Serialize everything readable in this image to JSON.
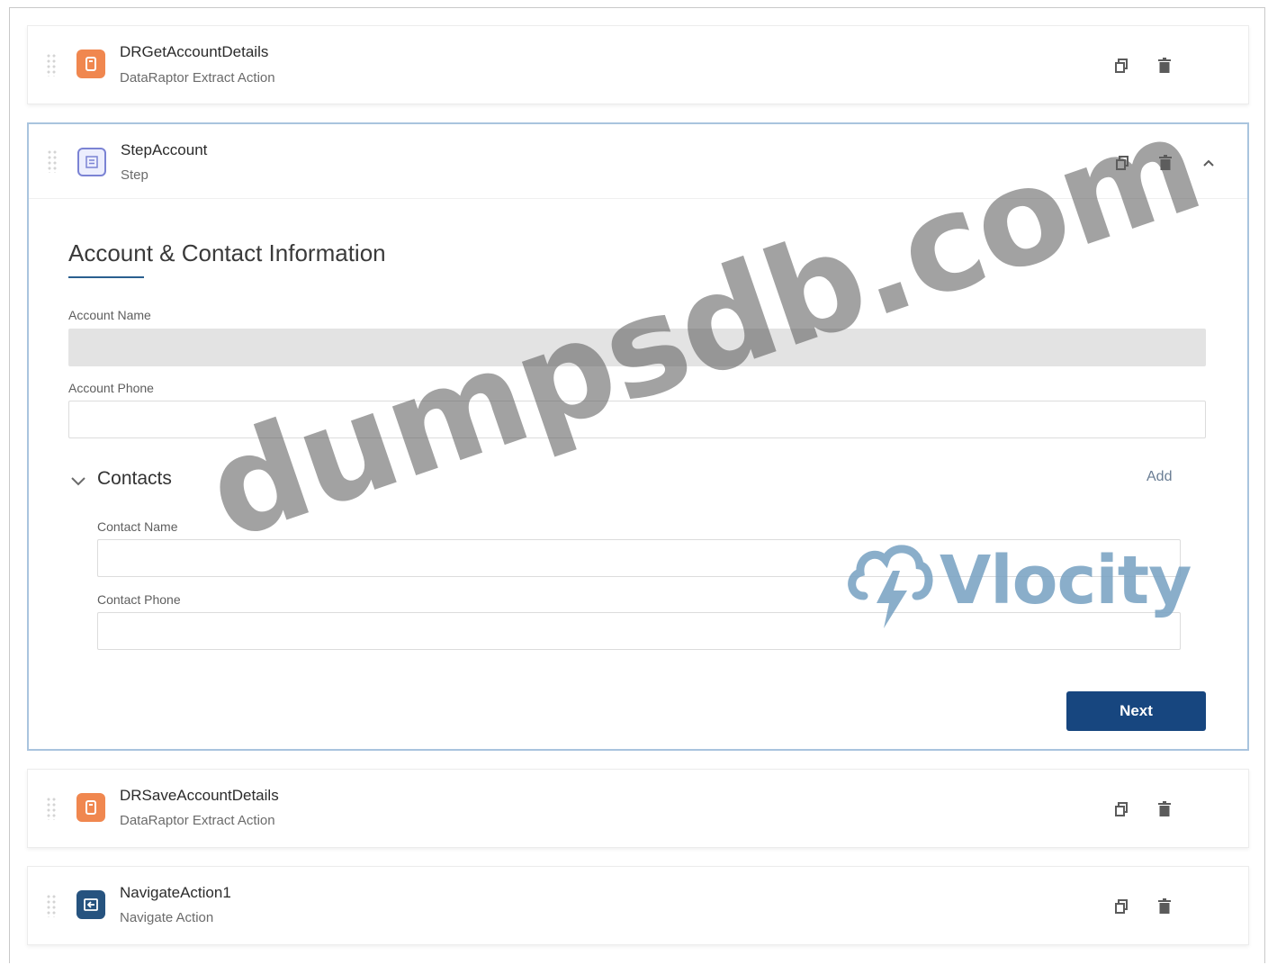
{
  "cards": [
    {
      "title": "DRGetAccountDetails",
      "subtitle": "DataRaptor Extract Action",
      "icon": "dataraptor-icon"
    },
    {
      "title": "StepAccount",
      "subtitle": "Step",
      "icon": "step-icon"
    },
    {
      "title": "DRSaveAccountDetails",
      "subtitle": "DataRaptor Extract Action",
      "icon": "dataraptor-icon"
    },
    {
      "title": "NavigateAction1",
      "subtitle": "Navigate Action",
      "icon": "navigate-icon"
    }
  ],
  "form": {
    "title": "Account & Contact Information",
    "account_name_label": "Account Name",
    "account_name_value": "",
    "account_phone_label": "Account Phone",
    "account_phone_value": "",
    "contacts_label": "Contacts",
    "add_label": "Add",
    "contact_name_label": "Contact Name",
    "contact_name_value": "",
    "contact_phone_label": "Contact Phone",
    "contact_phone_value": "",
    "next_label": "Next"
  },
  "watermarks": {
    "site": "dumpsdb.com",
    "brand": "Vlocity"
  },
  "colors": {
    "accent": "#17467f",
    "dataraptor_icon": "#f0874f",
    "step_icon": "#7b83d4",
    "navigate_icon": "#26537f",
    "expanded_border": "#a9c4de"
  }
}
